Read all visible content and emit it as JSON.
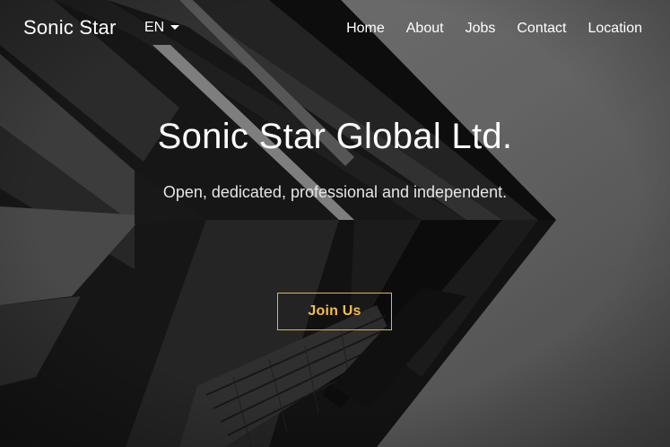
{
  "navbar": {
    "brand": "Sonic Star",
    "language": "EN",
    "links": [
      {
        "label": "Home"
      },
      {
        "label": "About"
      },
      {
        "label": "Jobs"
      },
      {
        "label": "Contact"
      },
      {
        "label": "Location"
      }
    ]
  },
  "hero": {
    "title": "Sonic Star Global Ltd.",
    "tagline": "Open, dedicated, professional and independent.",
    "cta_label": "Join Us"
  },
  "icons": {
    "language_dropdown": "caret-down-icon"
  },
  "colors": {
    "accent": "#f2bd4a",
    "text": "#ffffff",
    "background": "#6e6e6e"
  }
}
